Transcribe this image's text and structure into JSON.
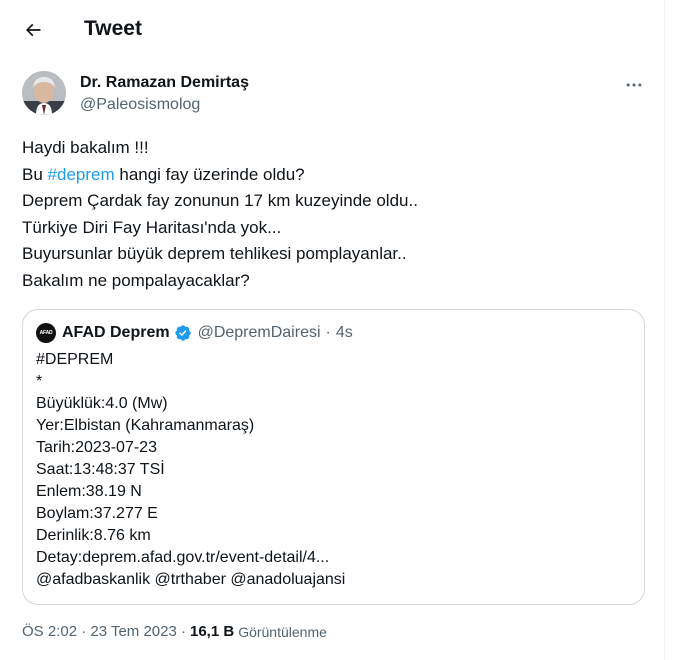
{
  "header": {
    "title": "Tweet",
    "back_icon": "arrow-left-icon"
  },
  "author": {
    "name": "Dr. Ramazan Demirtaş",
    "handle": "@Paleosismolog",
    "more_icon": "more-horizontal-icon"
  },
  "tweet": {
    "line1": "Haydi bakalım !!!",
    "line2_prefix": "Bu ",
    "line2_hashtag": "#deprem",
    "line2_suffix": " hangi fay üzerinde oldu?",
    "line3": "Deprem Çardak fay zonunun 17 km kuzeyinde oldu..",
    "line4": "Türkiye Diri Fay Haritası'nda yok...",
    "line5": "Buyursunlar büyük deprem tehlikesi pomplayanlar..",
    "line6": "Bakalım ne pompalayacaklar?"
  },
  "quoted": {
    "avatar_text": "AFAD",
    "name": "AFAD Deprem",
    "verified_icon": "verified-badge-icon",
    "handle": "@DepremDairesi",
    "separator": "·",
    "time": "4s",
    "lines": [
      "#DEPREM",
      "*",
      "Büyüklük:4.0 (Mw)",
      "Yer:Elbistan (Kahramanmaraş)",
      "Tarih:2023-07-23",
      "Saat:13:48:37 TSİ",
      "Enlem:38.19 N",
      "Boylam:37.277 E",
      "Derinlik:8.76 km",
      "Detay:deprem.afad.gov.tr/event-detail/4...",
      "@afadbaskanlik @trthaber @anadoluajansi"
    ]
  },
  "meta": {
    "timestamp": "ÖS 2:02 · 23 Tem 2023 ·",
    "views_count": "16,1 B",
    "views_label": "Görüntülenme"
  },
  "colors": {
    "accent": "#1d9bf0",
    "secondary_text": "#536471",
    "border": "#cfd9de"
  }
}
